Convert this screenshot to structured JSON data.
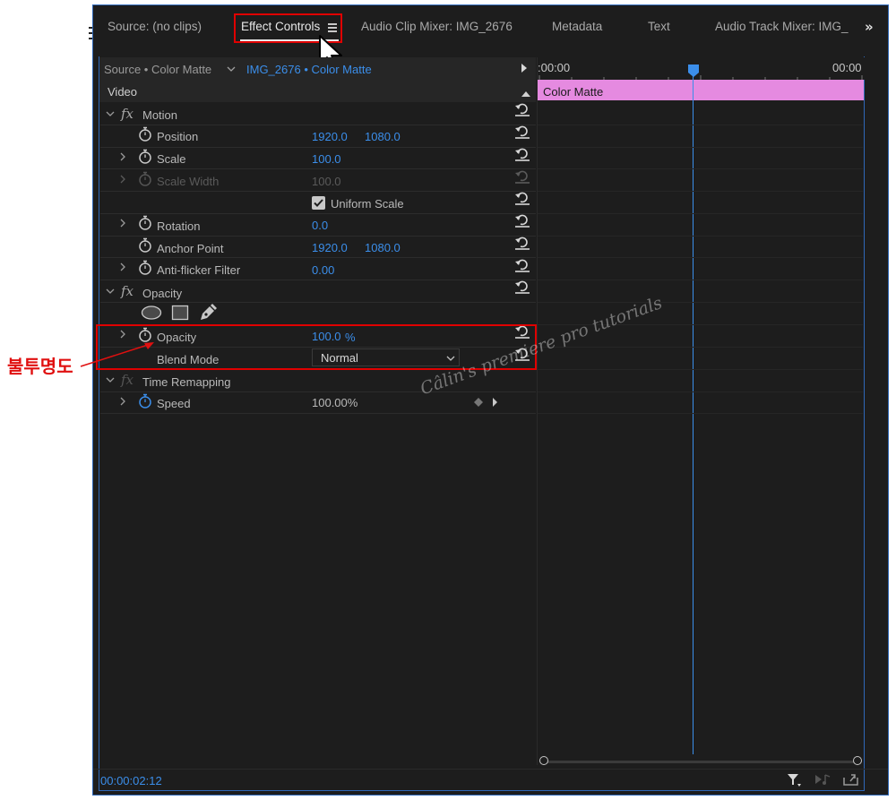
{
  "tabs": [
    {
      "label": "Source: (no clips)"
    },
    {
      "label": "Effect Controls"
    },
    {
      "label": "Audio Clip Mixer: IMG_2676"
    },
    {
      "label": "Metadata"
    },
    {
      "label": "Text"
    },
    {
      "label": "Audio Track Mixer: IMG_"
    }
  ],
  "source_bar": {
    "source": "Source • Color Matte",
    "clip": "IMG_2676 • Color Matte"
  },
  "timeline": {
    "start_time": ":00:00",
    "end_time": "00:00",
    "clip_label": "Color Matte",
    "clip_color": "#e58ae0",
    "playhead_color": "#3b8eea"
  },
  "video_header": "Video",
  "motion": {
    "label": "Motion",
    "position": {
      "label": "Position",
      "x": "1920.0",
      "y": "1080.0"
    },
    "scale": {
      "label": "Scale",
      "value": "100.0"
    },
    "scale_width": {
      "label": "Scale Width",
      "value": "100.0"
    },
    "uniform_scale": {
      "label": "Uniform Scale",
      "checked": true
    },
    "rotation": {
      "label": "Rotation",
      "value": "0.0"
    },
    "anchor_point": {
      "label": "Anchor Point",
      "x": "1920.0",
      "y": "1080.0"
    },
    "anti_flicker": {
      "label": "Anti-flicker Filter",
      "value": "0.00"
    }
  },
  "opacity": {
    "label": "Opacity",
    "tools": [
      "ellipse-mask-icon",
      "rectangle-mask-icon",
      "pen-mask-icon"
    ],
    "opacity_prop": {
      "label": "Opacity",
      "value": "100.0",
      "unit": "%"
    },
    "blend_mode": {
      "label": "Blend Mode",
      "value": "Normal"
    }
  },
  "time_remapping": {
    "label": "Time Remapping",
    "speed": {
      "label": "Speed",
      "value": "100.00%"
    }
  },
  "footer": {
    "timecode": "00:00:02:12"
  },
  "annotation": {
    "text": "불투명도",
    "color": "#e01010"
  },
  "watermark": "Câlin's premiere pro tutorials"
}
